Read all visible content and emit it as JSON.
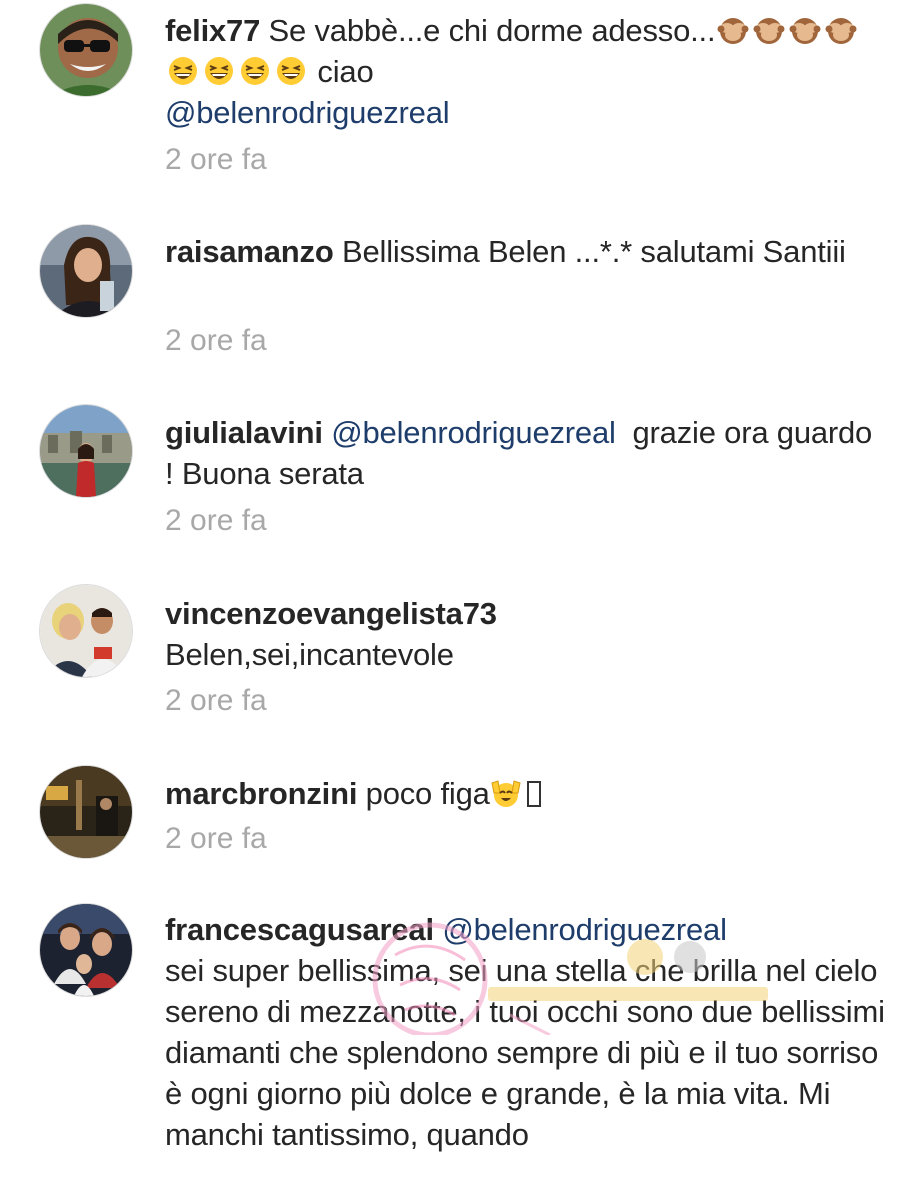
{
  "comments": [
    {
      "username": "felix77",
      "text_before": "Se vabbè...e chi dorme adesso...",
      "emoji_see_no_evil": [
        "see-no-evil-monkey-icon",
        "see-no-evil-monkey-icon",
        "see-no-evil-monkey-icon",
        "see-no-evil-monkey-icon"
      ],
      "emoji_grin": [
        "grinning-squinting-face-icon",
        "grinning-squinting-face-icon",
        "grinning-squinting-face-icon",
        "grinning-squinting-face-icon"
      ],
      "text_after": " ciao",
      "mention": "@belenrodriguezreal",
      "time": "2 ore fa"
    },
    {
      "username": "raisamanzo",
      "text": "Bellissima Belen ...*.* salutami Santiii",
      "time": "2 ore fa"
    },
    {
      "username": "giulialavini",
      "mention": "@belenrodriguezreal",
      "text": "  grazie ora guardo ! Buona serata",
      "time": "2 ore fa"
    },
    {
      "username": "vincenzoevangelista73",
      "text": "Belen,sei,incantevole",
      "time": "2 ore fa"
    },
    {
      "username": "marcbronzini",
      "text": "poco figa",
      "emoji": "raising-hands-smiling-icon",
      "time": "2 ore fa"
    },
    {
      "username": "francescagusareal",
      "mention": "@belenrodriguezreal",
      "text": "sei super  bellissima, sei una stella che brilla nel cielo sereno di mezzanotte, i tuoi occhi sono due bellissimi diamanti che splendono sempre di più e il tuo sorriso è ogni giorno più dolce e grande, è la mia vita. Mi manchi tantissimo,  quando"
    }
  ],
  "colors": {
    "text": "#262626",
    "mention": "#1e3d6b",
    "timestamp": "#a8a8a8"
  }
}
